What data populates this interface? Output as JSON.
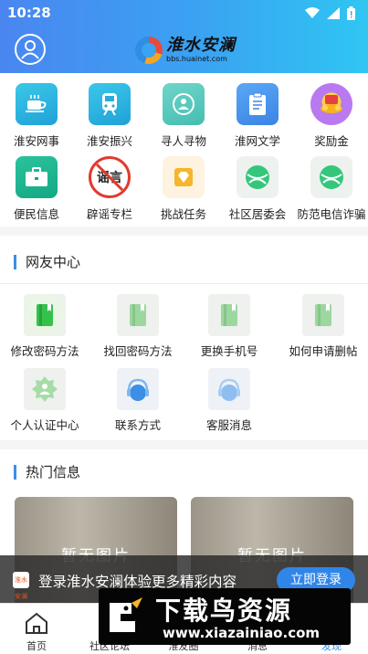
{
  "status_bar": {
    "time": "10:28"
  },
  "header": {
    "logo_text": "淮水安澜",
    "logo_subtext": "bbs.huainet.com"
  },
  "quick_grid": [
    {
      "label": "淮安网事",
      "icon": "teacup-icon"
    },
    {
      "label": "淮安振兴",
      "icon": "train-icon"
    },
    {
      "label": "寻人寻物",
      "icon": "person-search-icon"
    },
    {
      "label": "淮网文学",
      "icon": "document-icon"
    },
    {
      "label": "奖励金",
      "icon": "reward-gift-icon"
    },
    {
      "label": "便民信息",
      "icon": "briefcase-icon"
    },
    {
      "label": "辟谣专栏",
      "icon": "no-rumor-icon",
      "badge": "谣言"
    },
    {
      "label": "挑战任务",
      "icon": "diamond-task-icon"
    },
    {
      "label": "社区居委会",
      "icon": "globe-icon"
    },
    {
      "label": "防范电信诈骗",
      "icon": "globe-icon"
    }
  ],
  "user_center": {
    "title": "网友中心",
    "items": [
      {
        "label": "修改密码方法",
        "icon": "book-icon"
      },
      {
        "label": "找回密码方法",
        "icon": "book-icon"
      },
      {
        "label": "更换手机号",
        "icon": "book-icon"
      },
      {
        "label": "如何申请删帖",
        "icon": "book-icon"
      },
      {
        "label": "个人认证中心",
        "icon": "verify-badge-icon"
      },
      {
        "label": "联系方式",
        "icon": "headset-icon"
      },
      {
        "label": "客服消息",
        "icon": "headset-icon"
      }
    ]
  },
  "hot_info": {
    "title": "热门信息",
    "cards": [
      {
        "placeholder": "暂无图片"
      },
      {
        "placeholder": "暂无图片"
      }
    ]
  },
  "login_banner": {
    "text": "登录淮水安澜体验更多精彩内容",
    "button": "立即登录",
    "app_icon_text": "淮水安澜"
  },
  "tabbar": [
    {
      "label": "首页",
      "icon": "home-icon"
    },
    {
      "label": "社区论坛",
      "icon": "forum-icon"
    },
    {
      "label": "淮友圈",
      "icon": "circle-icon"
    },
    {
      "label": "消息",
      "icon": "message-icon"
    },
    {
      "label": "发现",
      "icon": "discover-icon"
    }
  ],
  "watermark": {
    "title": "下载鸟资源",
    "url": "www.xiazainiao.com"
  },
  "colors": {
    "accent": "#3a8ee6",
    "header_start": "#4a86f0",
    "header_end": "#2fc6f2"
  }
}
